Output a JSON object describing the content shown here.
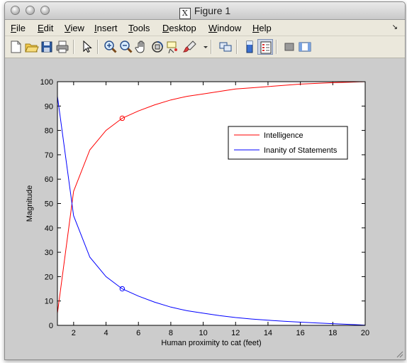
{
  "window": {
    "title": "Figure 1",
    "title_icon": "X"
  },
  "menu": [
    "File",
    "Edit",
    "View",
    "Insert",
    "Tools",
    "Desktop",
    "Window",
    "Help"
  ],
  "menu_accel": [
    "F",
    "E",
    "V",
    "I",
    "T",
    "D",
    "W",
    "H"
  ],
  "toolbar": {
    "icons": [
      "new-figure-icon",
      "open-file-icon",
      "save-icon",
      "print-icon",
      "edit-plot-arrow-icon",
      "zoom-in-icon",
      "zoom-out-icon",
      "pan-hand-icon",
      "rotate-3d-icon",
      "data-cursor-icon",
      "brush-icon",
      "brush-dropdown-icon",
      "link-plot-icon",
      "insert-colorbar-icon",
      "insert-legend-icon",
      "hide-plot-tools-icon",
      "show-plot-tools-icon"
    ]
  },
  "chart_data": {
    "type": "line",
    "xlabel": "Human proximity to cat (feet)",
    "ylabel": "Magnitude",
    "xlim": [
      1,
      20
    ],
    "ylim": [
      0,
      100
    ],
    "xticks": [
      2,
      4,
      6,
      8,
      10,
      12,
      14,
      16,
      18,
      20
    ],
    "yticks": [
      0,
      10,
      20,
      30,
      40,
      50,
      60,
      70,
      80,
      90,
      100
    ],
    "grid": false,
    "legend_position": "top-right",
    "series": [
      {
        "name": "Intelligence",
        "color": "#ff0000",
        "x": [
          1,
          2,
          3,
          4,
          5,
          6,
          7,
          8,
          9,
          10,
          11,
          12,
          13,
          14,
          15,
          16,
          17,
          18,
          19,
          20
        ],
        "y": [
          5,
          55,
          72,
          80,
          85,
          88,
          90.5,
          92.5,
          94,
          95,
          96,
          97,
          97.5,
          98,
          98.5,
          99,
          99.3,
          99.6,
          99.8,
          100
        ],
        "marker_at": [
          5,
          85
        ]
      },
      {
        "name": "Inanity of Statements",
        "color": "#0000ff",
        "x": [
          1,
          2,
          3,
          4,
          5,
          6,
          7,
          8,
          9,
          10,
          11,
          12,
          13,
          14,
          15,
          16,
          17,
          18,
          19,
          20
        ],
        "y": [
          94,
          45,
          28,
          20,
          15,
          12,
          9.5,
          7.5,
          6,
          5,
          4,
          3.2,
          2.6,
          2.1,
          1.7,
          1.3,
          1,
          0.7,
          0.4,
          0.1
        ],
        "marker_at": [
          5,
          15
        ]
      }
    ]
  }
}
